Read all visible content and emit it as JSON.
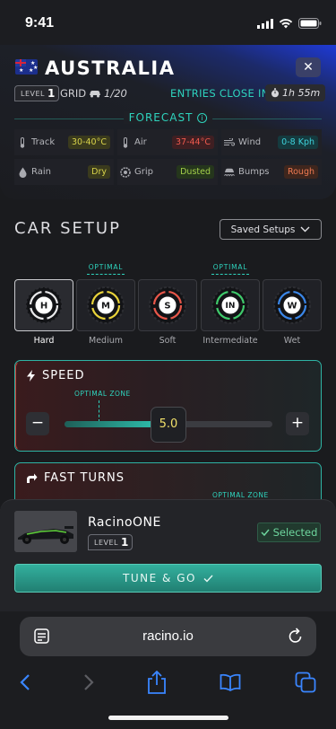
{
  "status_bar": {
    "time": "9:41"
  },
  "header": {
    "country": "AUSTRALIA",
    "level_label": "LEVEL",
    "level_value": "1",
    "grid_label": "GRID",
    "grid_value": "1/20",
    "entries_label": "ENTRIES CLOSE IN",
    "entries_time": "1h 55m"
  },
  "forecast": {
    "title": "FORECAST",
    "items": [
      {
        "label": "Track",
        "value": "30-40°C",
        "color": "yellow",
        "icon": "thermometer-icon"
      },
      {
        "label": "Air",
        "value": "37-44°C",
        "color": "red",
        "icon": "thermometer-icon"
      },
      {
        "label": "Wind",
        "value": "0-8 Kph",
        "color": "cyan",
        "icon": "wind-icon"
      },
      {
        "label": "Rain",
        "value": "Dry",
        "color": "yellow",
        "icon": "raindrop-icon"
      },
      {
        "label": "Grip",
        "value": "Dusted",
        "color": "green",
        "icon": "tyre-grip-icon"
      },
      {
        "label": "Bumps",
        "value": "Rough",
        "color": "orange",
        "icon": "car-bumps-icon"
      }
    ]
  },
  "setup": {
    "title": "CAR SETUP",
    "saved_label": "Saved Setups",
    "optimal_label": "OPTIMAL",
    "tyres": [
      {
        "letter": "H",
        "label": "Hard",
        "ring": "#e8e8ea",
        "optimal": false,
        "active": true
      },
      {
        "letter": "M",
        "label": "Medium",
        "ring": "#e8d23a",
        "optimal": true,
        "active": false
      },
      {
        "letter": "S",
        "label": "Soft",
        "ring": "#e8574a",
        "optimal": false,
        "active": false
      },
      {
        "letter": "IN",
        "label": "Intermediate",
        "ring": "#3fc96b",
        "optimal": true,
        "active": false
      },
      {
        "letter": "W",
        "label": "Wet",
        "ring": "#3a86e8",
        "optimal": false,
        "active": false
      }
    ],
    "speed": {
      "title": "SPEED",
      "zone_label": "OPTIMAL ZONE",
      "value": "5.0",
      "level": 0.5,
      "minus": "−",
      "plus": "+"
    },
    "fast_turns": {
      "title": "FAST TURNS",
      "zone_label": "OPTIMAL ZONE"
    }
  },
  "car": {
    "name": "RacinoONE",
    "level_label": "LEVEL",
    "level_value": "1",
    "selected_label": "Selected",
    "tune_label": "TUNE & GO"
  },
  "browser": {
    "url": "racino.io"
  },
  "colors": {
    "accent": "#2ed3bd",
    "brand_blue": "#1f3ad6"
  }
}
